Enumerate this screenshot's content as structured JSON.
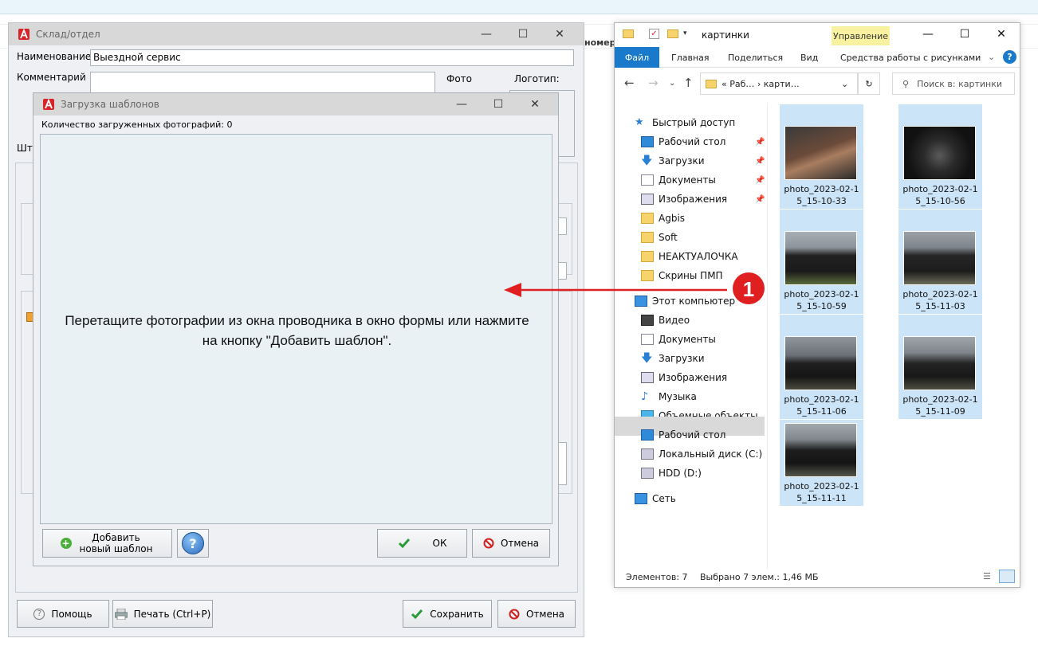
{
  "bg": {
    "column_header": "номера"
  },
  "sklad": {
    "title": "Склад/отдел",
    "name_label": "Наименование",
    "name_value": "Выездной сервис",
    "comment_label": "Комментарий",
    "photo_label": "Фото",
    "logo_label": "Логотип:",
    "barcode_label_partial": "Штр",
    "help_button": "Помощь",
    "print_button": "Печать (Ctrl+P)",
    "save_button": "Сохранить",
    "cancel_button": "Отмена"
  },
  "tpl": {
    "title": "Загрузка шаблонов",
    "count_label": "Количество загруженных фотографий: 0",
    "drop_message": "Перетащите фотографии из окна проводника в окно формы или нажмите на кнопку \"Добавить шаблон\".",
    "add_button": "Добавить новый шаблон",
    "ok_button": "ОК",
    "cancel_button": "Отмена"
  },
  "explorer": {
    "title": "картинки",
    "manage_tab": "Управление",
    "tabs": [
      "Файл",
      "Главная",
      "Поделиться",
      "Вид",
      "Средства работы с рисунками"
    ],
    "address": "« Раб… › карти…",
    "search_placeholder": "Поиск в: картинки",
    "tree": [
      "Быстрый доступ",
      "Рабочий стол",
      "Загрузки",
      "Документы",
      "Изображения",
      "Agbis",
      "Soft",
      "НЕАКТУАЛОЧКА",
      "Скрины ПМП",
      "Этот компьютер",
      "Видео",
      "Документы",
      "Загрузки",
      "Изображения",
      "Музыка",
      "Объемные объекты",
      "Рабочий стол",
      "Локальный диск (C:)",
      "HDD (D:)",
      "Сеть"
    ],
    "files": [
      {
        "name1": "photo_2023-02-1",
        "name2": "5_15-10-33"
      },
      {
        "name1": "photo_2023-02-1",
        "name2": "5_15-10-56"
      },
      {
        "name1": "photo_2023-02-1",
        "name2": "5_15-10-59"
      },
      {
        "name1": "photo_2023-02-1",
        "name2": "5_15-11-03"
      },
      {
        "name1": "photo_2023-02-1",
        "name2": "5_15-11-06"
      },
      {
        "name1": "photo_2023-02-1",
        "name2": "5_15-11-09"
      },
      {
        "name1": "photo_2023-02-1",
        "name2": "5_15-11-11"
      }
    ],
    "status_count": "Элементов: 7",
    "status_selected": "Выбрано 7 элем.: 1,46 МБ"
  },
  "annotation": {
    "step": "1",
    "color": "#e02020"
  }
}
